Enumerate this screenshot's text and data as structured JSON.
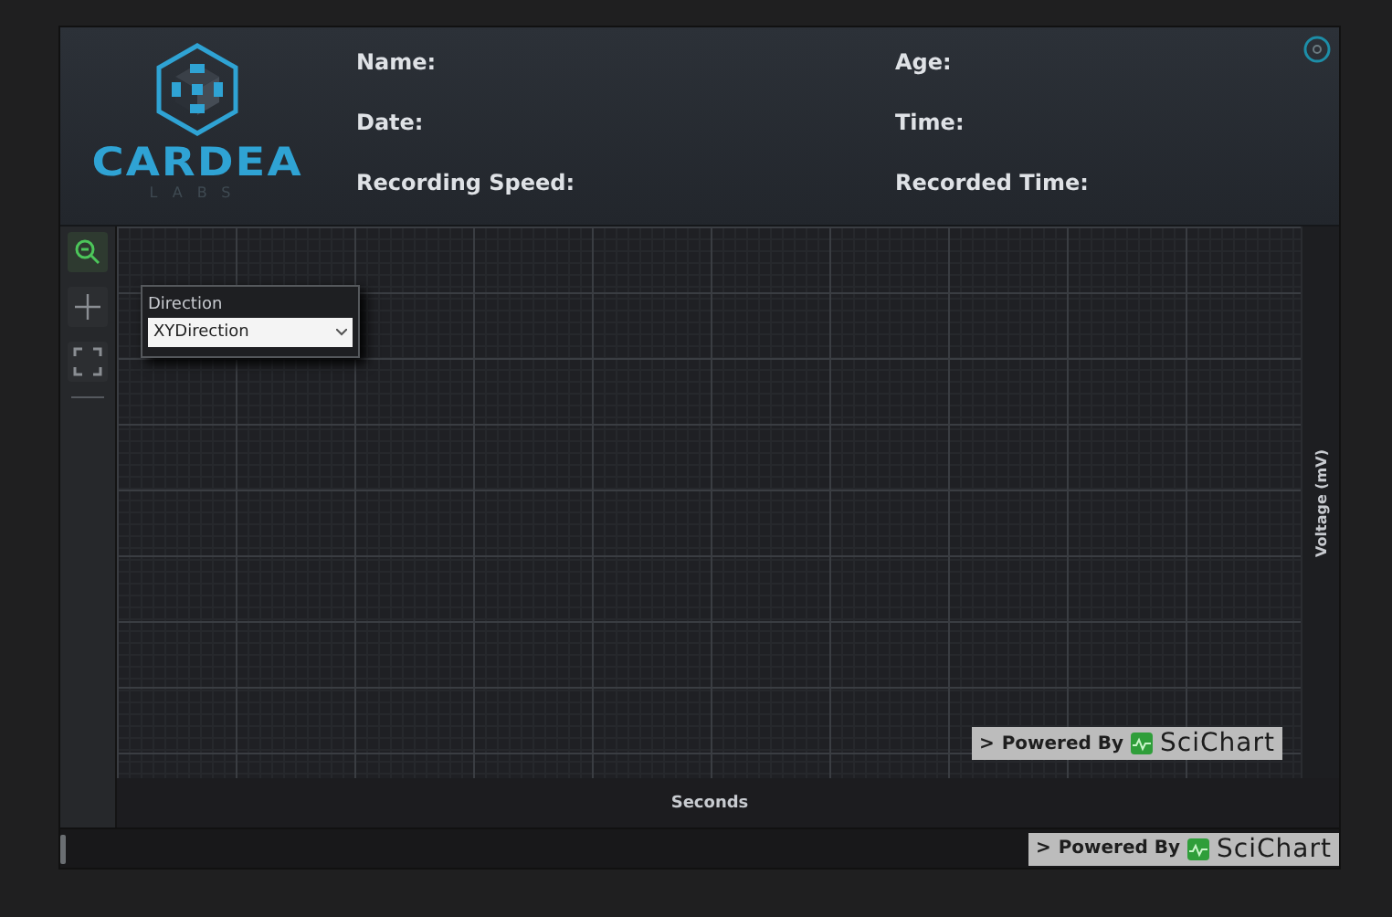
{
  "logo": {
    "name": "CARDEA",
    "sub": "LABS"
  },
  "fields": [
    {
      "label": "Name:"
    },
    {
      "label": "Age:"
    },
    {
      "label": "Date:"
    },
    {
      "label": "Time:"
    },
    {
      "label": "Recording Speed:"
    },
    {
      "label": "Recorded Time:"
    }
  ],
  "tools": [
    {
      "kind": "zoom",
      "selected": true
    },
    {
      "kind": "pan",
      "selected": false
    },
    {
      "kind": "extents",
      "selected": false
    }
  ],
  "direction_popup": {
    "label": "Direction",
    "value": "XYDirection"
  },
  "chart": {
    "xlabel": "Seconds",
    "ylabel": "Voltage (mV)"
  },
  "badges": [
    {
      "arrow": ">",
      "text": "Powered By",
      "brand": "SciChart"
    },
    {
      "arrow": ">",
      "text": "Powered By",
      "brand": "SciChart"
    }
  ]
}
